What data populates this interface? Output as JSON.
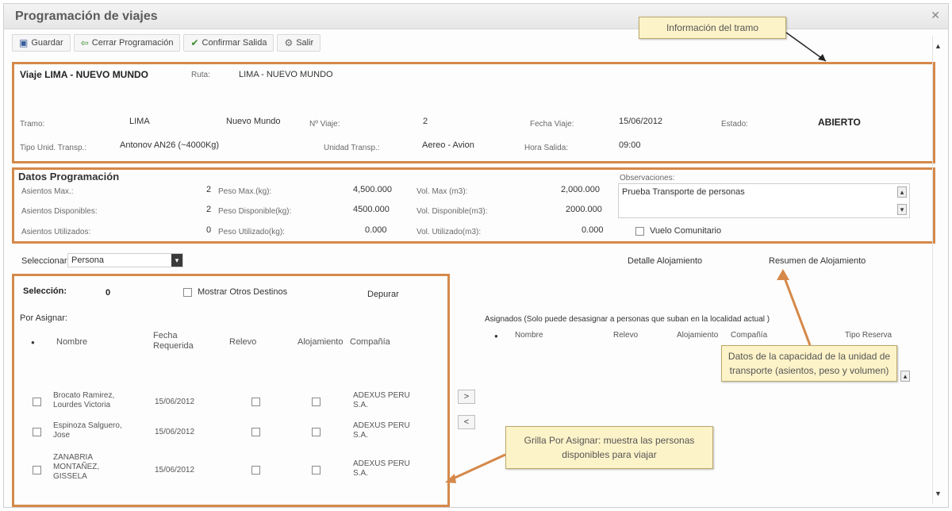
{
  "window": {
    "title": "Programación de viajes"
  },
  "toolbar": {
    "save": "Guardar",
    "close_prog": "Cerrar Programación",
    "confirm": "Confirmar Salida",
    "exit": "Salir"
  },
  "tramo": {
    "header_left": "Viaje LIMA - NUEVO MUNDO",
    "ruta_label": "Ruta:",
    "ruta_value": "LIMA - NUEVO MUNDO",
    "tramo_label": "Tramo:",
    "origin": "LIMA",
    "destination": "Nuevo Mundo",
    "nviaje_label": "Nº Viaje:",
    "nviaje_value": "2",
    "fecha_label": "Fecha Viaje:",
    "fecha_value": "15/06/2012",
    "estado_label": "Estado:",
    "estado_value": "ABIERTO",
    "tipo_label": "Tipo Unid. Transp.:",
    "tipo_value": "Antonov AN26 (~4000Kg)",
    "unidad_label": "Unidad Transp.:",
    "unidad_value": "Aereo - Avion",
    "hora_label": "Hora Salida:",
    "hora_value": "09:00"
  },
  "programacion": {
    "title": "Datos Programación",
    "asientos_max_label": "Asientos Max.:",
    "asientos_max": "2",
    "asientos_disp_label": "Asientos Disponibles:",
    "asientos_disp": "2",
    "asientos_util_label": "Asientos Utilizados:",
    "asientos_util": "0",
    "peso_max_label": "Peso Max.(kg):",
    "peso_max": "4,500.000",
    "peso_disp_label": "Peso Disponible(kg):",
    "peso_disp": "4500.000",
    "peso_util_label": "Peso Utilizado(kg):",
    "peso_util": "0.000",
    "vol_max_label": "Vol. Max (m3):",
    "vol_max": "2,000.000",
    "vol_disp_label": "Vol. Disponible(m3):",
    "vol_disp": "2000.000",
    "vol_util_label": "Vol. Utilizado(m3):",
    "vol_util": "0.000",
    "obs_label": "Observaciones:",
    "obs_value": "Prueba Transporte de personas",
    "vuelo_comunitario": "Vuelo Comunitario"
  },
  "selector": {
    "label": "Seleccionar:",
    "value": "Persona",
    "detalle_link": "Detalle Alojamiento",
    "resumen_link": "Resumen de Alojamiento"
  },
  "por_asignar": {
    "seleccion_label": "Selección:",
    "seleccion_value": "0",
    "mostrar_otros": "Mostrar Otros Destinos",
    "depurar": "Depurar",
    "title": "Por Asignar:",
    "col_nombre": "Nombre",
    "col_fecha": "Fecha Requerida",
    "col_relevo": "Relevo",
    "col_aloj": "Alojamiento",
    "col_compania": "Compañía",
    "rows": [
      {
        "nombre": "Brocato Ramirez, Lourdes Victoria",
        "fecha": "15/06/2012",
        "compania": "ADEXUS PERU S.A."
      },
      {
        "nombre": "Espinoza Salguero, Jose",
        "fecha": "15/06/2012",
        "compania": "ADEXUS PERU S.A."
      },
      {
        "nombre": "ZANABRIA MONTAÑEZ, GISSELA",
        "fecha": "15/06/2012",
        "compania": "ADEXUS PERU S.A."
      }
    ]
  },
  "asignados": {
    "title": "Asignados (Solo puede desasignar a personas que suban en la localidad actual )",
    "col_nombre": "Nombre",
    "col_relevo": "Relevo",
    "col_aloj": "Alojamiento",
    "col_compania": "Compañía",
    "col_tipo": "Tipo Reserva"
  },
  "buttons": {
    "move_right": ">",
    "move_left": "<"
  },
  "callouts": {
    "tramo": "Información del tramo",
    "capacidad": "Datos de la capacidad de la unidad de transporte (asientos, peso y volumen)",
    "grilla": "Grilla Por Asignar: muestra las personas disponibles para viajar"
  },
  "colors": {
    "annotation_border": "#d5894a",
    "callout_bg": "#fdf3c8"
  }
}
